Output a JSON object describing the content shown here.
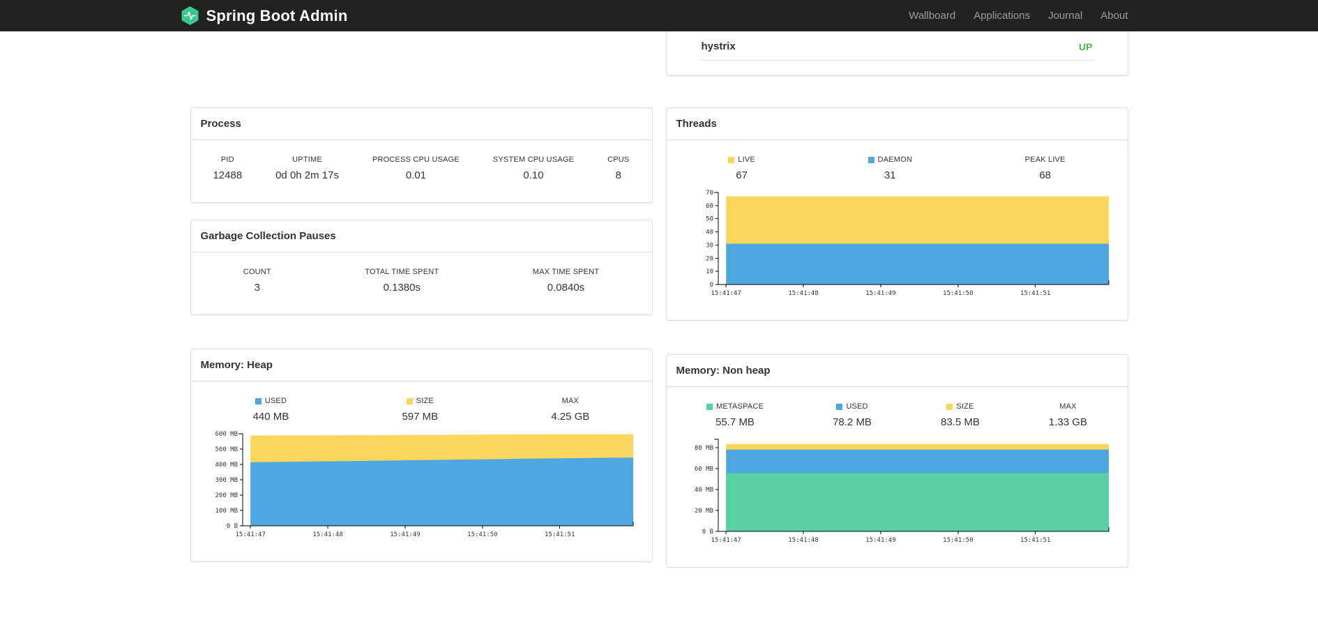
{
  "colors": {
    "navbar_bg": "#222222",
    "brand_logo_green": "#3cc88f",
    "nav_link_gray": "#9d9d9d",
    "status_up_green": "#4caf50",
    "chart_yellow": "#FBD65D",
    "chart_blue": "#4FA7E0",
    "chart_green": "#58D0A2",
    "card_border": "#dddddd"
  },
  "navbar": {
    "title": "Spring Boot Admin",
    "links": [
      "Wallboard",
      "Applications",
      "Journal",
      "About"
    ]
  },
  "applications_panel": {
    "rows": [
      {
        "name": "hystrix",
        "status": "UP"
      }
    ]
  },
  "process": {
    "title": "Process",
    "stats": [
      {
        "label": "PID",
        "value": "12488"
      },
      {
        "label": "UPTIME",
        "value": "0d 0h 2m 17s"
      },
      {
        "label": "PROCESS CPU USAGE",
        "value": "0.01"
      },
      {
        "label": "SYSTEM CPU USAGE",
        "value": "0.10"
      },
      {
        "label": "CPUS",
        "value": "8"
      }
    ]
  },
  "gc": {
    "title": "Garbage Collection Pauses",
    "stats": [
      {
        "label": "COUNT",
        "value": "3"
      },
      {
        "label": "TOTAL TIME SPENT",
        "value": "0.1380s"
      },
      {
        "label": "MAX TIME SPENT",
        "value": "0.0840s"
      }
    ]
  },
  "threads": {
    "title": "Threads",
    "legend": [
      {
        "label": "LIVE",
        "value": "67"
      },
      {
        "label": "DAEMON",
        "value": "31"
      },
      {
        "label": "PEAK LIVE",
        "value": "68"
      }
    ]
  },
  "memory_heap": {
    "title": "Memory: Heap",
    "legend": [
      {
        "label": "USED",
        "value": "440 MB"
      },
      {
        "label": "SIZE",
        "value": "597 MB"
      },
      {
        "label": "MAX",
        "value": "4.25 GB"
      }
    ]
  },
  "memory_nonheap": {
    "title": "Memory: Non heap",
    "legend": [
      {
        "label": "METASPACE",
        "value": "55.7 MB"
      },
      {
        "label": "USED",
        "value": "78.2 MB"
      },
      {
        "label": "SIZE",
        "value": "83.5 MB"
      },
      {
        "label": "MAX",
        "value": "1.33 GB"
      }
    ]
  },
  "chart_data": [
    {
      "id": "threads-chart",
      "type": "area",
      "stacked": true,
      "title": "Threads",
      "xlabel": "",
      "ylabel": "",
      "legend_position": "top",
      "grid": false,
      "x_labels": [
        "15:41:47",
        "15:41:48",
        "15:41:49",
        "15:41:50",
        "15:41:51"
      ],
      "ylim": [
        0,
        70
      ],
      "yticks": [
        0,
        10,
        20,
        30,
        40,
        50,
        60,
        70
      ],
      "ytick_labels": [
        "0",
        "10",
        "20",
        "30",
        "40",
        "50",
        "60",
        "70"
      ],
      "series_note": "values are stacked absolute tops, painted in listed order (back to front)",
      "series": [
        {
          "name": "LIVE",
          "color": "#FBD65D",
          "values": [
            67,
            67,
            67,
            67,
            67,
            67
          ]
        },
        {
          "name": "DAEMON",
          "color": "#4FA7E0",
          "values": [
            31,
            31,
            31,
            31,
            31,
            31
          ]
        }
      ]
    },
    {
      "id": "memory-heap-chart",
      "type": "area",
      "stacked": true,
      "title": "Memory: Heap",
      "xlabel": "",
      "ylabel": "",
      "legend_position": "top",
      "grid": false,
      "x_labels": [
        "15:41:47",
        "15:41:48",
        "15:41:49",
        "15:41:50",
        "15:41:51"
      ],
      "ylim": [
        0,
        600
      ],
      "yticks": [
        0,
        100,
        200,
        300,
        400,
        500,
        600
      ],
      "ytick_labels": [
        "0 B",
        "100 MB",
        "200 MB",
        "300 MB",
        "400 MB",
        "500 MB",
        "600 MB"
      ],
      "series_note": "values in MB; stacked absolute tops, painted in listed order",
      "series": [
        {
          "name": "SIZE",
          "color": "#FBD65D",
          "values": [
            588,
            590,
            592,
            594,
            596,
            597
          ]
        },
        {
          "name": "USED",
          "color": "#4FA7E0",
          "values": [
            414,
            420,
            427,
            433,
            440,
            445
          ]
        }
      ]
    },
    {
      "id": "memory-nonheap-chart",
      "type": "area",
      "stacked": true,
      "title": "Memory: Non heap",
      "xlabel": "",
      "ylabel": "",
      "legend_position": "top",
      "grid": false,
      "x_labels": [
        "15:41:47",
        "15:41:48",
        "15:41:49",
        "15:41:50",
        "15:41:51"
      ],
      "ylim": [
        0,
        88
      ],
      "yticks": [
        0,
        20,
        40,
        60,
        80
      ],
      "ytick_labels": [
        "0 B",
        "20 MB",
        "40 MB",
        "60 MB",
        "80 MB"
      ],
      "series_note": "values in MB; stacked absolute tops, painted in listed order",
      "series": [
        {
          "name": "SIZE",
          "color": "#FBD65D",
          "values": [
            83.5,
            83.5,
            83.5,
            83.5,
            83.5,
            83.5
          ]
        },
        {
          "name": "USED",
          "color": "#4FA7E0",
          "values": [
            78.2,
            78.2,
            78.2,
            78.2,
            78.2,
            78.2
          ]
        },
        {
          "name": "METASPACE",
          "color": "#58D0A2",
          "values": [
            55.7,
            55.7,
            55.7,
            55.7,
            55.7,
            55.7
          ]
        }
      ]
    }
  ]
}
